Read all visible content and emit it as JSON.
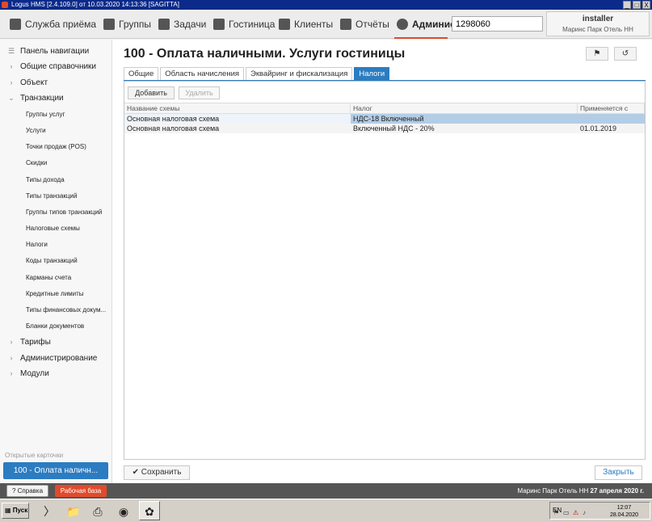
{
  "window": {
    "title": "Logus HMS [2.4.109.0] от 10.03.2020 14:13:36 [SAGITTA]",
    "buttons": [
      "_",
      "□",
      "X"
    ]
  },
  "topmenu": {
    "items": [
      {
        "label": "Служба приёма",
        "icon": "frontdesk-icon"
      },
      {
        "label": "Группы",
        "icon": "groups-icon"
      },
      {
        "label": "Задачи",
        "icon": "tasks-icon"
      },
      {
        "label": "Гостиница",
        "icon": "hotel-icon"
      },
      {
        "label": "Клиенты",
        "icon": "clients-icon"
      },
      {
        "label": "Отчёты",
        "icon": "reports-icon"
      },
      {
        "label": "Админис",
        "icon": "gears-icon"
      }
    ],
    "search_value": "1298060",
    "user_name": "installer",
    "user_hotel": "Маринс Парк Отель НН"
  },
  "sidebar": {
    "items": [
      {
        "label": "Панель навигации",
        "icon": "menu-icon"
      },
      {
        "label": "Общие справочники",
        "icon": "chevron-right-icon"
      },
      {
        "label": "Объект",
        "icon": "chevron-right-icon"
      },
      {
        "label": "Транзакции",
        "icon": "chevron-down-icon"
      }
    ],
    "subitems": [
      "Группы услуг",
      "Услуги",
      "Точки продаж (POS)",
      "Скидки",
      "Типы дохода",
      "Типы транзакций",
      "Группы типов транзакций",
      "Налоговые схемы",
      "Налоги",
      "Коды транзакций",
      "Карманы счета",
      "Кредитные лимиты",
      "Типы финансовых докум...",
      "Бланки документов"
    ],
    "items_after": [
      {
        "label": "Тарифы",
        "icon": "chevron-right-icon"
      },
      {
        "label": "Администрирование",
        "icon": "chevron-right-icon"
      },
      {
        "label": "Модули",
        "icon": "chevron-right-icon"
      }
    ],
    "open_cards_label": "Открытые карточки",
    "open_card": "100 - Оплата наличн..."
  },
  "main": {
    "title": "100 - Оплата наличными. Услуги гостиницы",
    "tabs": [
      "Общие",
      "Область начисления",
      "Эквайринг и фискализация",
      "Налоги"
    ],
    "active_tab": 3,
    "add_label": "Добавить",
    "delete_label": "Удалить",
    "columns": [
      "Название схемы",
      "Налог",
      "Применяется с"
    ],
    "rows": [
      [
        "Основная налоговая схема",
        "НДС-18 Включенный",
        ""
      ],
      [
        "Основная налоговая схема",
        "Включенный НДС - 20%",
        "01.01.2019"
      ]
    ],
    "save_label": "Сохранить",
    "close_label": "Закрыть"
  },
  "statusbar": {
    "help_label": "Справка",
    "db_label": "Рабочая база",
    "hotel": "Маринс Парк Отель НН",
    "date": "27 апреля 2020 г."
  },
  "taskbar": {
    "start_label": "Пуск",
    "lang": "EN",
    "time": "12:07",
    "date": "28.04.2020"
  },
  "colors": {
    "accent": "#2c7cc1",
    "brand_red": "#e14a2a",
    "selection": "#b4cde6"
  }
}
